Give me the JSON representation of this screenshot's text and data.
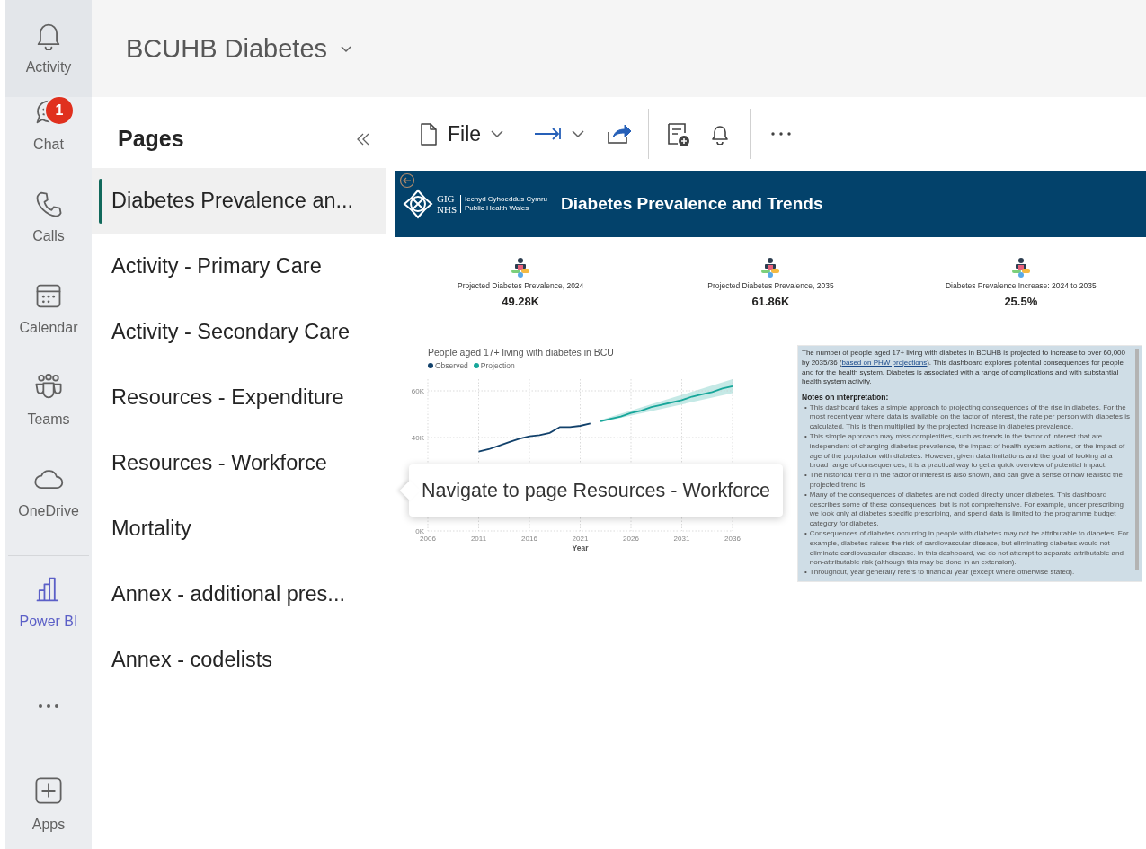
{
  "rail": {
    "items": [
      {
        "label": "Activity",
        "selected": false
      },
      {
        "label": "Chat",
        "badge": "1",
        "selected": false
      },
      {
        "label": "Calls",
        "selected": false
      },
      {
        "label": "Calendar",
        "selected": false
      },
      {
        "label": "Teams",
        "selected": false
      },
      {
        "label": "OneDrive",
        "selected": false
      },
      {
        "label": "Power BI",
        "selected": true
      }
    ],
    "apps_label": "Apps"
  },
  "header": {
    "title": "BCUHB Diabetes"
  },
  "pages": {
    "title": "Pages",
    "items": [
      {
        "label": "Diabetes Prevalence an...",
        "selected": true
      },
      {
        "label": "Activity - Primary Care",
        "selected": false
      },
      {
        "label": "Activity - Secondary Care",
        "selected": false
      },
      {
        "label": "Resources - Expenditure",
        "selected": false
      },
      {
        "label": "Resources - Workforce",
        "selected": false
      },
      {
        "label": "Mortality",
        "selected": false
      },
      {
        "label": "Annex - additional pres...",
        "selected": false
      },
      {
        "label": "Annex - codelists",
        "selected": false
      }
    ]
  },
  "toolbar": {
    "file_label": "File"
  },
  "report": {
    "title": "Diabetes Prevalence and Trends",
    "logo": {
      "mark_top": "GIG",
      "mark_bottom": "NHS",
      "org_welsh": "Iechyd Cyhoeddus Cymru",
      "org_english": "Public Health Wales"
    },
    "kpis": [
      {
        "label": "Projected Diabetes Prevalence, 2024",
        "value": "49.28K"
      },
      {
        "label": "Projected Diabetes Prevalence, 2035",
        "value": "61.86K"
      },
      {
        "label": "Diabetes Prevalence Increase: 2024 to 2035",
        "value": "25.5%"
      }
    ],
    "chart": {
      "chart_data": {
        "type": "line",
        "title": "People aged 17+ living with diabetes in BCU",
        "xlabel": "Year",
        "x": [
          2011,
          2012,
          2013,
          2014,
          2015,
          2016,
          2017,
          2018,
          2019,
          2020,
          2021,
          2022,
          2023,
          2024,
          2025,
          2026,
          2027,
          2028,
          2029,
          2030,
          2031,
          2032,
          2033,
          2034,
          2035,
          2036
        ],
        "series": [
          {
            "name": "Observed",
            "color": "#12416b",
            "values": [
              34000,
              35000,
              36500,
              38000,
              39500,
              40500,
              41000,
              42000,
              44500,
              44500,
              45000,
              46000,
              null,
              null,
              null,
              null,
              null,
              null,
              null,
              null,
              null,
              null,
              null,
              null,
              null,
              null
            ]
          },
          {
            "name": "Projection",
            "color": "#17a69a",
            "values": [
              null,
              null,
              null,
              null,
              null,
              null,
              null,
              null,
              null,
              null,
              null,
              null,
              47000,
              48000,
              49000,
              50500,
              51500,
              53000,
              54000,
              55000,
              56000,
              57500,
              58500,
              59500,
              61000,
              62000
            ]
          }
        ],
        "grid": true,
        "legend": true,
        "xlim": [
          2006,
          2036
        ],
        "ylim": [
          0,
          65000
        ],
        "xticks": [
          2006,
          2011,
          2016,
          2021,
          2026,
          2031,
          2036
        ],
        "yticks": [
          {
            "value": 0,
            "label": "0K"
          },
          {
            "value": 40000,
            "label": "40K"
          },
          {
            "value": 60000,
            "label": "60K"
          }
        ]
      }
    },
    "notes": {
      "intro": "The number of people aged 17+ living with diabetes in BCUHB is projected to increase to over 60,000 by 2035/36 (",
      "intro_link": "based on PHW projections",
      "intro_rest": "). This dashboard explores potential consequences for people and for the health system. Diabetes is associated with a range of complications and with substantial health system activity.",
      "heading": "Notes on interpretation:",
      "bullet_marker": "•",
      "bullets": [
        "This dashboard takes a simple approach to projecting consequences of the rise in diabetes. For the most recent year where data is available on the factor of interest, the rate per person with diabetes is calculated. This is then multiplied by the projected increase in diabetes prevalence.",
        "This simple approach may miss complexities, such as trends in the factor of interest that are independent of changing diabetes prevalence, the impact of health system actions, or the impact of age of the population with diabetes. However, given data limitations and the goal of looking at a broad range of consequences, it is a practical way to get a quick overview of potential impact.",
        "The historical trend in the factor of interest is also shown, and can give a sense of how realistic the projected trend is.",
        "Many of the consequences of diabetes are not coded directly under diabetes. This dashboard describes some of these consequences, but is not comprehensive. For example, under prescribing we look only at diabetes specific prescribing, and spend data is limited to the programme budget category for diabetes.",
        "Consequences of diabetes occurring in people with diabetes may not be attributable to diabetes. For example, diabetes raises the risk of cardiovascular disease, but eliminating diabetes would not eliminate cardiovascular disease. In this dashboard, we do not attempt to separate attributable and non-attributable risk (although this may be done in an extension).",
        "Throughout, year generally refers to financial year (except where otherwise stated)."
      ]
    }
  },
  "tooltip": {
    "text": "Navigate to page Resources - Workforce"
  }
}
